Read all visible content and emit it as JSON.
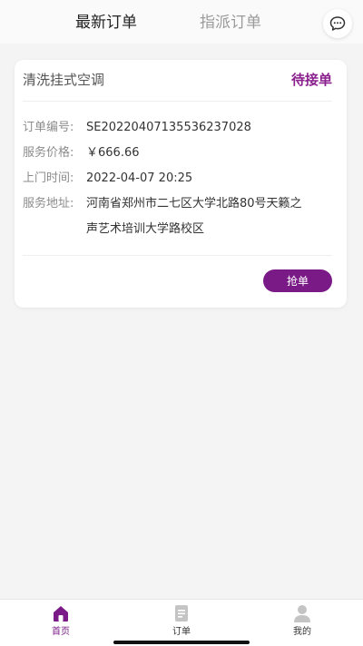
{
  "colors": {
    "accent": "#7a1a86",
    "status": "#8a1f8e",
    "background": "#f4f4f4"
  },
  "header": {
    "tabs": [
      {
        "label": "最新订单",
        "active": true
      },
      {
        "label": "指派订单",
        "active": false
      }
    ],
    "message_icon": "chat-bubble-icon"
  },
  "order": {
    "title": "清洗挂式空调",
    "status": "待接单",
    "fields": [
      {
        "label": "订单编号:",
        "value": "SE20220407135536237028"
      },
      {
        "label": "服务价格:",
        "value": "￥666.66"
      },
      {
        "label": "上门时间:",
        "value": "2022-04-07 20:25"
      },
      {
        "label": "服务地址:",
        "value": "河南省郑州市二七区大学北路80号天籁之声艺术培训大学路校区"
      }
    ],
    "action_label": "抢单"
  },
  "tabbar": {
    "items": [
      {
        "label": "首页",
        "icon": "home-icon",
        "active": true
      },
      {
        "label": "订单",
        "icon": "order-icon",
        "active": false
      },
      {
        "label": "我的",
        "icon": "user-icon",
        "active": false
      }
    ]
  }
}
